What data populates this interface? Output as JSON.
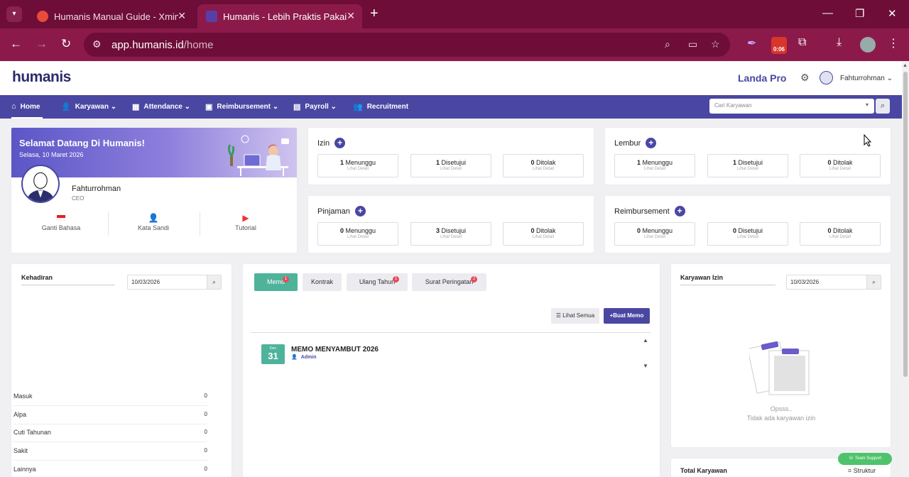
{
  "browser": {
    "tabs": [
      {
        "title": "Humanis Manual Guide - Xmind"
      },
      {
        "title": "Humanis - Lebih Praktis Pakai HR"
      }
    ],
    "url_host": "app.humanis.id",
    "url_path": "/home",
    "timer": "0:06"
  },
  "header": {
    "logo": "humanis",
    "company": "Landa Pro",
    "user": "Fahturrohman"
  },
  "nav": {
    "items": [
      "Home",
      "Karyawan",
      "Attendance",
      "Reimbursement",
      "Payroll",
      "Recruitment"
    ],
    "search_placeholder": "Cari Karyawan"
  },
  "welcome": {
    "title": "Selamat Datang Di Humanis!",
    "date": "Selasa, 10 Maret 2026",
    "name": "Fahturrohman",
    "role": "CEO",
    "actions": [
      "Ganti Bahasa",
      "Kata Sandi",
      "Tutorial"
    ]
  },
  "stats": {
    "detail_label": "Lihat Detail",
    "izin": {
      "title": "Izin",
      "items": [
        [
          "1",
          "Menunggu"
        ],
        [
          "1",
          "Disetujui"
        ],
        [
          "0",
          "Ditolak"
        ]
      ]
    },
    "lembur": {
      "title": "Lembur",
      "items": [
        [
          "1",
          "Menunggu"
        ],
        [
          "1",
          "Disetujui"
        ],
        [
          "0",
          "Ditolak"
        ]
      ]
    },
    "pinjaman": {
      "title": "Pinjaman",
      "items": [
        [
          "0",
          "Menunggu"
        ],
        [
          "3",
          "Disetujui"
        ],
        [
          "0",
          "Ditolak"
        ]
      ]
    },
    "reimbursement": {
      "title": "Reimbursement",
      "items": [
        [
          "0",
          "Menunggu"
        ],
        [
          "0",
          "Disetujui"
        ],
        [
          "0",
          "Ditolak"
        ]
      ]
    }
  },
  "kehadiran": {
    "title": "Kehadiran",
    "date": "10/03/2026",
    "rows": [
      [
        "Masuk",
        "0"
      ],
      [
        "Alpa",
        "0"
      ],
      [
        "Cuti Tahunan",
        "0"
      ],
      [
        "Sakit",
        "0"
      ],
      [
        "Lainnya",
        "0"
      ]
    ]
  },
  "memo": {
    "tabs": [
      {
        "label": "Memo",
        "badge": "1"
      },
      {
        "label": "Kontrak",
        "badge": ""
      },
      {
        "label": "Ulang Tahun",
        "badge": "1"
      },
      {
        "label": "Surat Peringatan",
        "badge": "2"
      }
    ],
    "lihat_semua": "Lihat Semua",
    "buat_memo": "Buat Memo",
    "item": {
      "month": "Dec",
      "day": "31",
      "title": "MEMO MENYAMBUT 2026",
      "author": "Admin"
    }
  },
  "karyawan_izin": {
    "title": "Karyawan Izin",
    "date": "10/03/2026",
    "empty_title": "Opsss..",
    "empty_text": "Tidak ada karyawan izin"
  },
  "total_karyawan": {
    "title": "Total Karyawan",
    "struktur": "Struktur"
  },
  "support": "Team Support",
  "colors": {
    "primary": "#4a47a3",
    "accent": "#4fb39b",
    "chrome": "#8b1a4a"
  }
}
